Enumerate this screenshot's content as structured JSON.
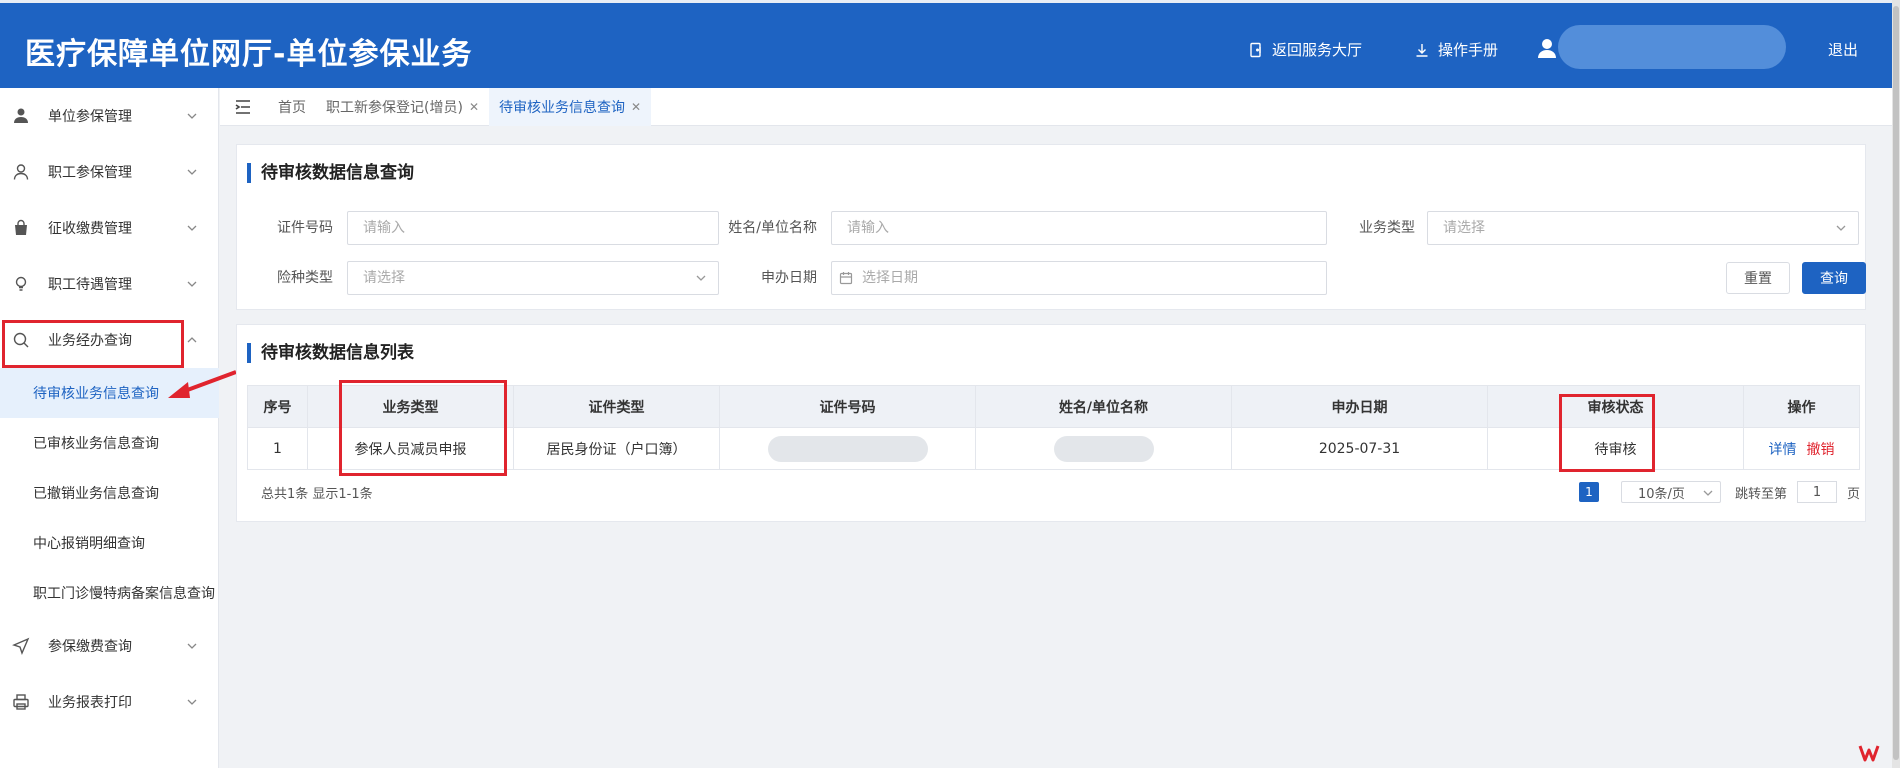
{
  "header": {
    "title": "医疗保障单位网厅-单位参保业务",
    "back_label": "返回服务大厅",
    "manual_label": "操作手册",
    "logout_label": "退出"
  },
  "sidebar": {
    "items": [
      {
        "label": "单位参保管理",
        "icon": "user-badge-icon"
      },
      {
        "label": "职工参保管理",
        "icon": "person-icon"
      },
      {
        "label": "征收缴费管理",
        "icon": "bag-icon"
      },
      {
        "label": "职工待遇管理",
        "icon": "bulb-icon"
      },
      {
        "label": "业务经办查询",
        "icon": "search-icon"
      },
      {
        "label": "参保缴费查询",
        "icon": "send-icon"
      },
      {
        "label": "业务报表打印",
        "icon": "printer-icon"
      }
    ],
    "sub_items": [
      "待审核业务信息查询",
      "已审核业务信息查询",
      "已撤销业务信息查询",
      "中心报销明细查询",
      "职工门诊慢特病备案信息查询"
    ]
  },
  "tabs": [
    {
      "label": "首页"
    },
    {
      "label": "职工新参保登记(增员)"
    },
    {
      "label": "待审核业务信息查询"
    }
  ],
  "query_panel": {
    "title": "待审核数据信息查询",
    "id_no_label": "证件号码",
    "id_no_placeholder": "请输入",
    "name_label": "姓名/单位名称",
    "name_placeholder": "请输入",
    "biz_type_label": "业务类型",
    "biz_type_placeholder": "请选择",
    "insurance_label": "险种类型",
    "insurance_placeholder": "请选择",
    "date_label": "申办日期",
    "date_placeholder": "选择日期",
    "reset_label": "重置",
    "query_label": "查询"
  },
  "list_panel": {
    "title": "待审核数据信息列表",
    "columns": [
      "序号",
      "业务类型",
      "证件类型",
      "证件号码",
      "姓名/单位名称",
      "申办日期",
      "审核状态",
      "操作"
    ],
    "rows": [
      {
        "index": "1",
        "biz_type": "参保人员减员申报",
        "id_type": "居民身份证（户口簿）",
        "date": "2025-07-31",
        "status": "待审核",
        "action_detail": "详情",
        "action_revoke": "撤销"
      }
    ],
    "summary": "总共1条 显示1-1条",
    "pagination": {
      "current_page": "1",
      "page_size": "10条/页",
      "jump_prefix": "跳转至第",
      "jump_value": "1",
      "jump_suffix": "页"
    }
  }
}
